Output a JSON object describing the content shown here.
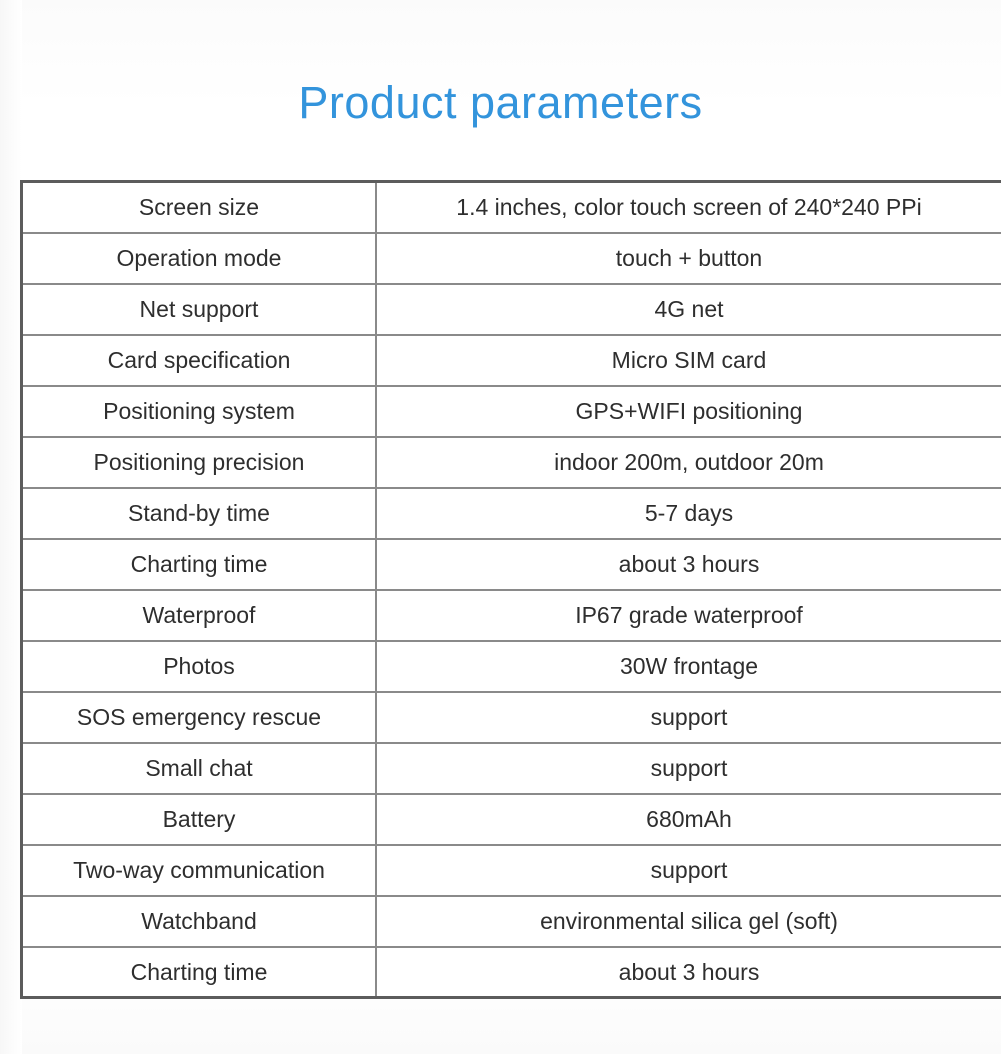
{
  "page": {
    "title": "Product parameters",
    "title_color": "#3394dc",
    "background_color": "#ffffff",
    "text_color": "#2e2e2e",
    "table_border_color": "#5c5c5c",
    "table_divider_color": "#8a8a8a"
  },
  "table": {
    "rows": [
      {
        "name": "Screen size",
        "value": "1.4 inches, color touch screen of 240*240 PPi"
      },
      {
        "name": "Operation mode",
        "value": "touch + button"
      },
      {
        "name": "Net support",
        "value": "4G net"
      },
      {
        "name": "Card specification",
        "value": "Micro SIM card"
      },
      {
        "name": "Positioning system",
        "value": "GPS+WIFI positioning"
      },
      {
        "name": "Positioning precision",
        "value": "indoor 200m, outdoor 20m"
      },
      {
        "name": "Stand-by time",
        "value": "5-7 days"
      },
      {
        "name": "Charting time",
        "value": "about 3 hours"
      },
      {
        "name": "Waterproof",
        "value": "IP67 grade waterproof"
      },
      {
        "name": "Photos",
        "value": "30W frontage"
      },
      {
        "name": "SOS emergency rescue",
        "value": "support"
      },
      {
        "name": "Small chat",
        "value": "support"
      },
      {
        "name": "Battery",
        "value": "680mAh"
      },
      {
        "name": "Two-way communication",
        "value": "support"
      },
      {
        "name": "Watchband",
        "value": "environmental silica gel (soft)"
      },
      {
        "name": "Charting time",
        "value": "about 3 hours"
      }
    ]
  }
}
